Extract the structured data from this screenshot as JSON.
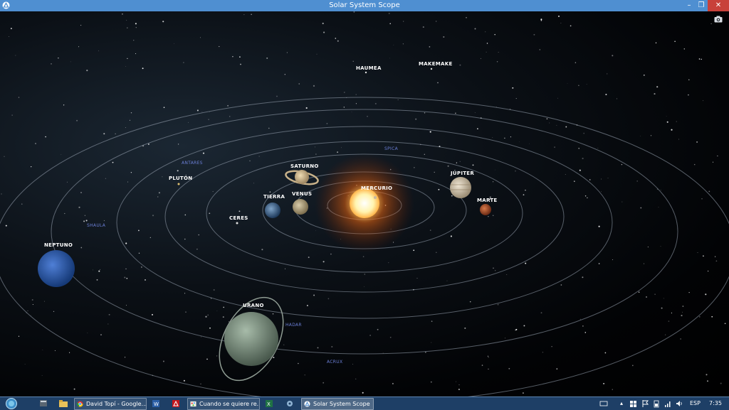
{
  "window": {
    "title": "Solar System Scope",
    "minimize_glyph": "–",
    "maximize_glyph": "❐",
    "close_glyph": "✕"
  },
  "planets": {
    "mercurio": "MERCURIO",
    "venus": "VENUS",
    "tierra": "TIERRA",
    "marte": "MARTE",
    "jupiter": "JÚPITER",
    "saturno": "SATURNO",
    "urano": "URANO",
    "neptuno": "NEPTUNO",
    "pluton": "PLUTÓN",
    "ceres": "CERES",
    "haumea": "HAUMEA",
    "makemake": "MAKEMAKE"
  },
  "stars": {
    "spica": "SPICA",
    "antares": "ANTARES",
    "shaula": "SHAULA",
    "hadar": "HADAR",
    "acrux": "ACRUX"
  },
  "taskbar": {
    "items": [
      {
        "label": "David Topí - Google...",
        "icon": "chrome-icon"
      },
      {
        "label": "Cuando se quiere re...",
        "icon": "paint-icon"
      },
      {
        "label": "Solar System Scope",
        "icon": "solar-system-scope-icon"
      }
    ],
    "language": "ESP",
    "clock": "7:35"
  },
  "colors": {
    "titlebar": "#4f8fd1",
    "close": "#c8413a",
    "taskbar": "#1e3f66",
    "star_label": "#6b7fd6"
  }
}
